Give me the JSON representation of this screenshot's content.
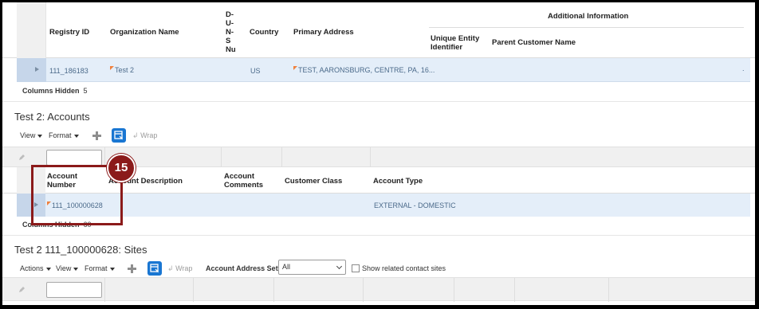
{
  "registry": {
    "headers": {
      "registry_id": "Registry ID",
      "organization_name": "Organization Name",
      "duns": [
        "D-",
        "U-",
        "N-",
        "S",
        "Nu"
      ],
      "country": "Country",
      "primary_address": "Primary Address",
      "additional_information": "Additional Information",
      "unique_entity_identifier": [
        "Unique Entity",
        "Identifier"
      ],
      "parent_customer_name": "Parent Customer Name"
    },
    "row": {
      "registry_id": "111_186183",
      "organization_name": "Test 2",
      "country": "US",
      "primary_address": "TEST, AARONSBURG, CENTRE, PA, 16...",
      "trailing": "."
    },
    "columns_hidden_label": "Columns Hidden",
    "columns_hidden_count": "5"
  },
  "accounts": {
    "title": "Test 2: Accounts",
    "toolbar": {
      "view": "View",
      "format": "Format",
      "wrap": "Wrap"
    },
    "headers": {
      "account_number": [
        "Account",
        "Number"
      ],
      "account_description": "Account Description",
      "account_comments": [
        "Account",
        "Comments"
      ],
      "customer_class": "Customer Class",
      "account_type": "Account Type"
    },
    "row": {
      "account_number": "111_100000628",
      "account_type": "EXTERNAL - DOMESTIC"
    },
    "columns_hidden_label": "Columns Hidden",
    "columns_hidden_count": "60"
  },
  "callout": {
    "number": "15",
    "color": "#8b1a1a"
  },
  "sites": {
    "title": "Test 2 111_100000628: Sites",
    "toolbar": {
      "actions": "Actions",
      "view": "View",
      "format": "Format",
      "wrap": "Wrap",
      "account_address_set_label": "Account Address Set",
      "account_address_set_value": "All",
      "show_related_contact_sites": "Show related contact sites"
    }
  },
  "colors": {
    "accent": "#1976d2",
    "selected_row": "#e4eef9",
    "link": "#4b6a8a",
    "flag": "#f0803c"
  }
}
